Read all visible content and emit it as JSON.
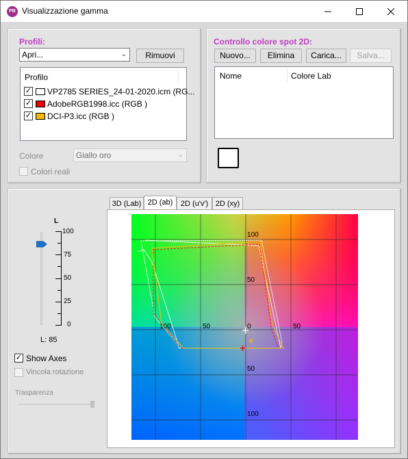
{
  "window": {
    "title": "Visualizzazione gamma",
    "app_icon_text": "PB"
  },
  "profiles_panel": {
    "label": "Profili:",
    "open_combo_value": "Apri...",
    "remove_label": "Rimuovi",
    "list_header": "Profilo",
    "items": [
      {
        "name": "VP2785 SERIES_24-01-2020.icm (RG...",
        "checked": true,
        "color": "#ffffff"
      },
      {
        "name": "AdobeRGB1998.icc (RGB )",
        "checked": true,
        "color": "#e60000"
      },
      {
        "name": "DCI-P3.icc (RGB )",
        "checked": true,
        "color": "#f5b800"
      }
    ],
    "color_label": "Colore",
    "color_value": "Giallo oro",
    "real_colors_label": "Colori reali"
  },
  "spot_panel": {
    "label": "Controllo colore spot 2D:",
    "new_label": "Nuovo...",
    "delete_label": "Elimina",
    "load_label": "Carica...",
    "save_label": "Salva...",
    "col_name": "Nome",
    "col_lab": "Colore Lab"
  },
  "left_controls": {
    "l_axis_label": "L",
    "l_ticks": [
      "100",
      "75",
      "50",
      "25",
      "0"
    ],
    "l_value": "L: 85",
    "show_axes_label": "Show Axes",
    "lock_rotation_label": "Vincola rotazione",
    "transparency_label": "Trasparenza"
  },
  "tabs": [
    "3D (Lab)",
    "2D (ab)",
    "2D (u'v')",
    "2D (xy)"
  ],
  "active_tab": "2D (ab)",
  "plot": {
    "labels_top": [
      "100",
      "50"
    ],
    "labels_mid": [
      "100",
      "50",
      "0",
      "50"
    ],
    "labels_bottom": [
      "50",
      "100"
    ]
  }
}
